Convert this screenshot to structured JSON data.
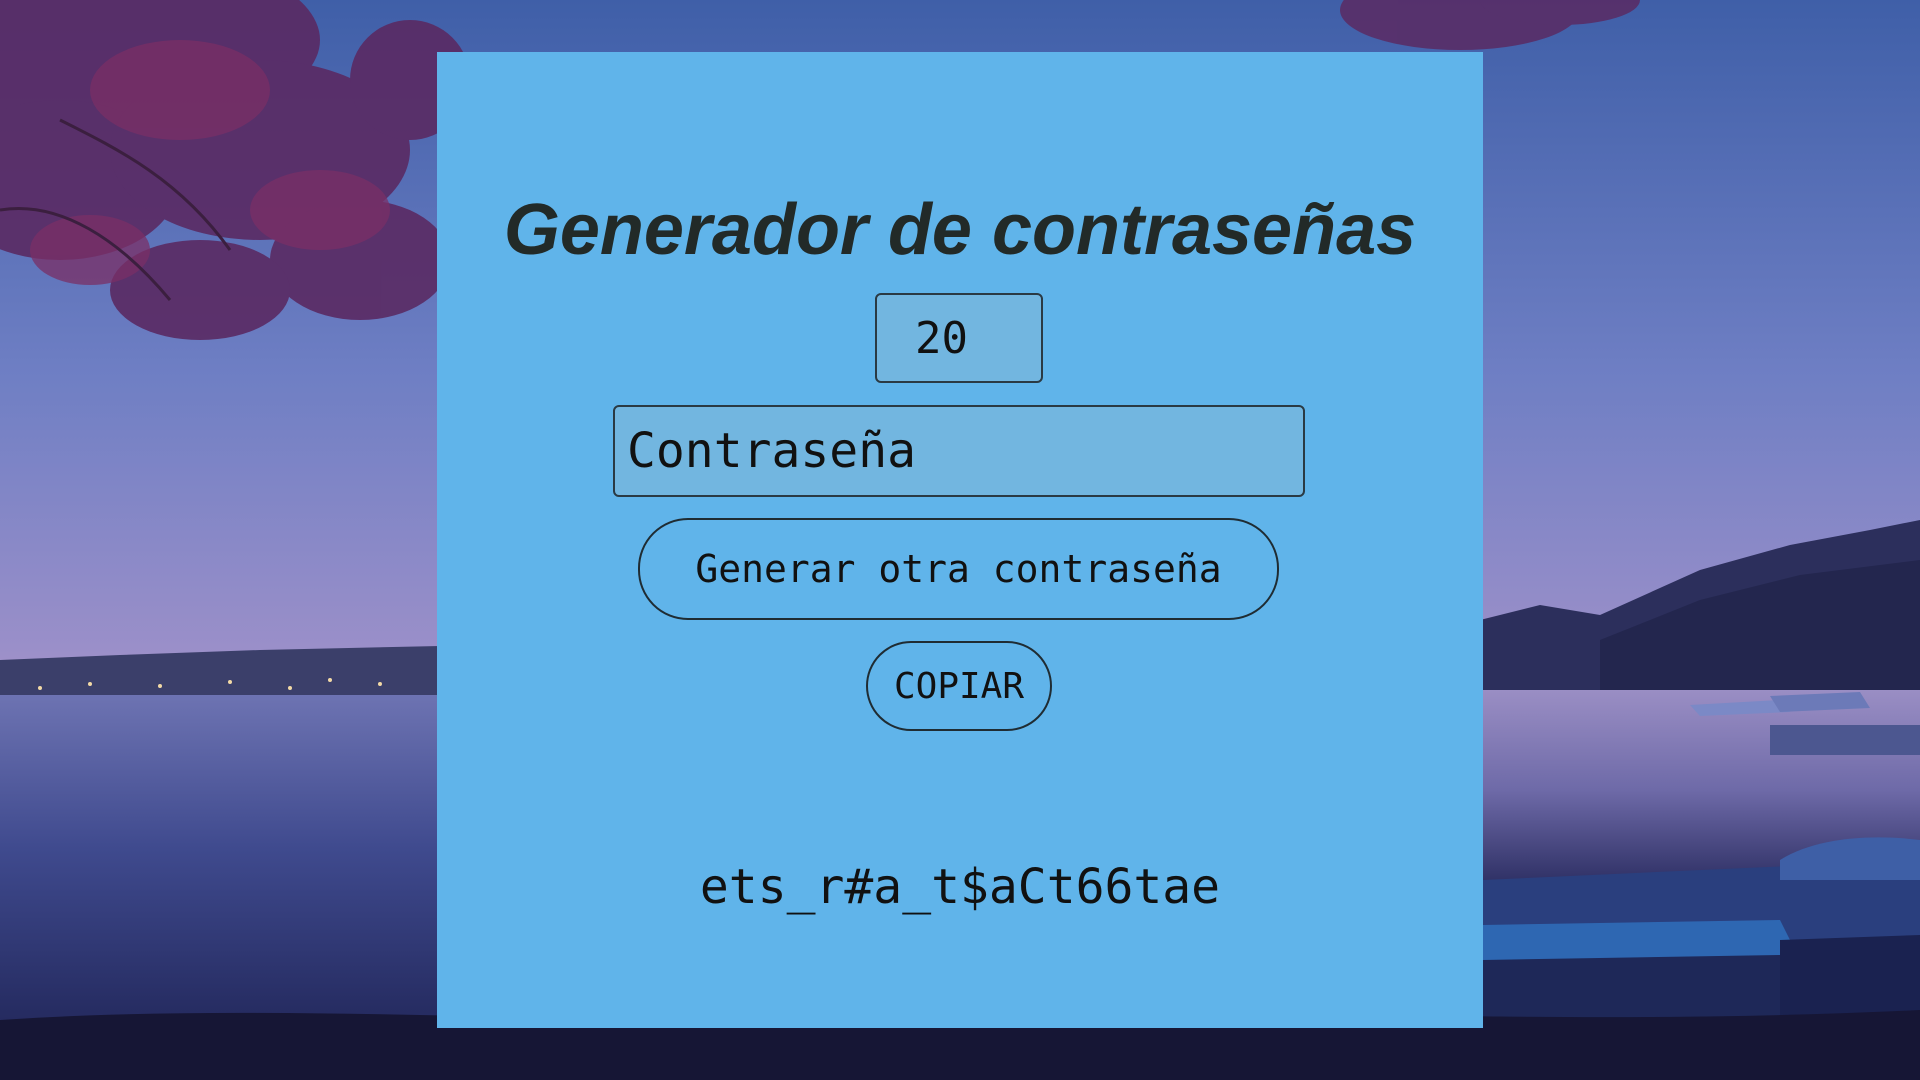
{
  "app": {
    "title": "Generador de contraseñas"
  },
  "length_input": {
    "value": "20"
  },
  "password_field": {
    "placeholder": "Contraseña"
  },
  "buttons": {
    "generate_label": "Generar otra contraseña",
    "copy_label": "COPIAR"
  },
  "result": {
    "password": "ets_r#a_t$aCt66tae"
  },
  "colors": {
    "panel": "#60b4ea",
    "input_bg": "#72b6e0",
    "text": "#111111",
    "title_text": "#222a28"
  }
}
